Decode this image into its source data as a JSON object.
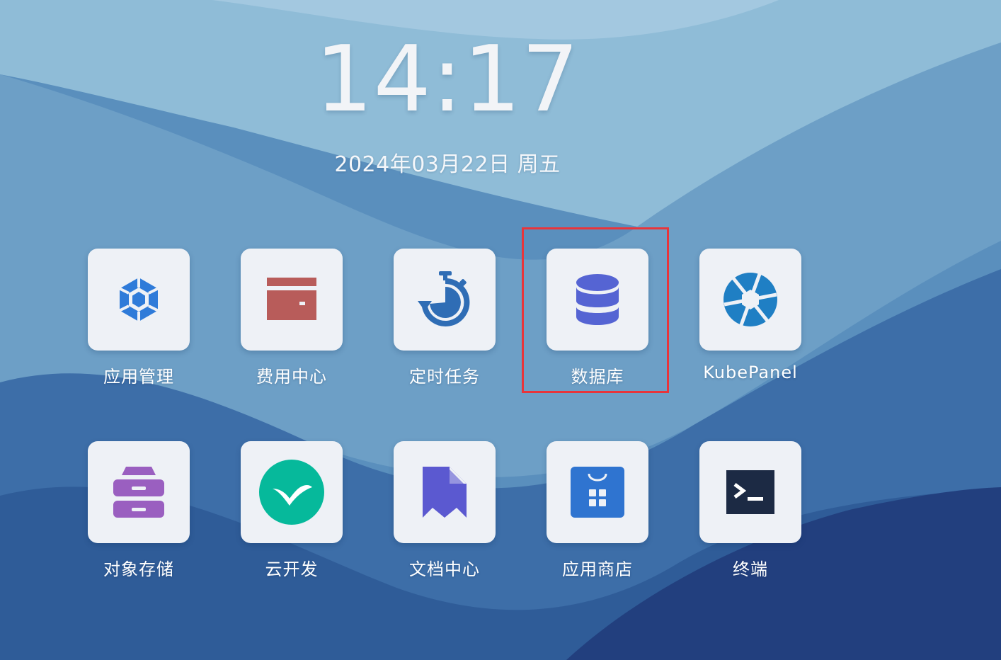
{
  "clock": {
    "time": "14:17",
    "date": "2024年03月22日 周五"
  },
  "apps": [
    {
      "id": "app-management",
      "label": "应用管理",
      "icon": "hexagon-cube-icon"
    },
    {
      "id": "billing-center",
      "label": "费用中心",
      "icon": "wallet-icon"
    },
    {
      "id": "scheduled-tasks",
      "label": "定时任务",
      "icon": "stopwatch-icon"
    },
    {
      "id": "database",
      "label": "数据库",
      "icon": "database-icon"
    },
    {
      "id": "kubepanel",
      "label": "KubePanel",
      "icon": "aperture-icon"
    },
    {
      "id": "object-storage",
      "label": "对象存储",
      "icon": "drawer-icon"
    },
    {
      "id": "cloud-dev",
      "label": "云开发",
      "icon": "cloud-dev-logo-icon"
    },
    {
      "id": "docs-center",
      "label": "文档中心",
      "icon": "document-bookmark-icon"
    },
    {
      "id": "app-store",
      "label": "应用商店",
      "icon": "shopping-bag-icon"
    },
    {
      "id": "terminal",
      "label": "终端",
      "icon": "terminal-icon"
    }
  ],
  "highlighted_app": "database",
  "colors": {
    "highlight_border": "#e8353b",
    "tile_background": "#eef1f6",
    "hexagon_blue": "#2f7bd9",
    "wallet_red": "#b85c5a",
    "stopwatch_blue": "#2f6db5",
    "database_indigo": "#5564d3",
    "aperture_blue": "#1f7fc4",
    "drawer_purple": "#9a5fc0",
    "cloud_dev_green": "#06b99b",
    "docs_indigo": "#5b59d0",
    "store_blue": "#2f74d0",
    "terminal_navy": "#1c2a44"
  }
}
